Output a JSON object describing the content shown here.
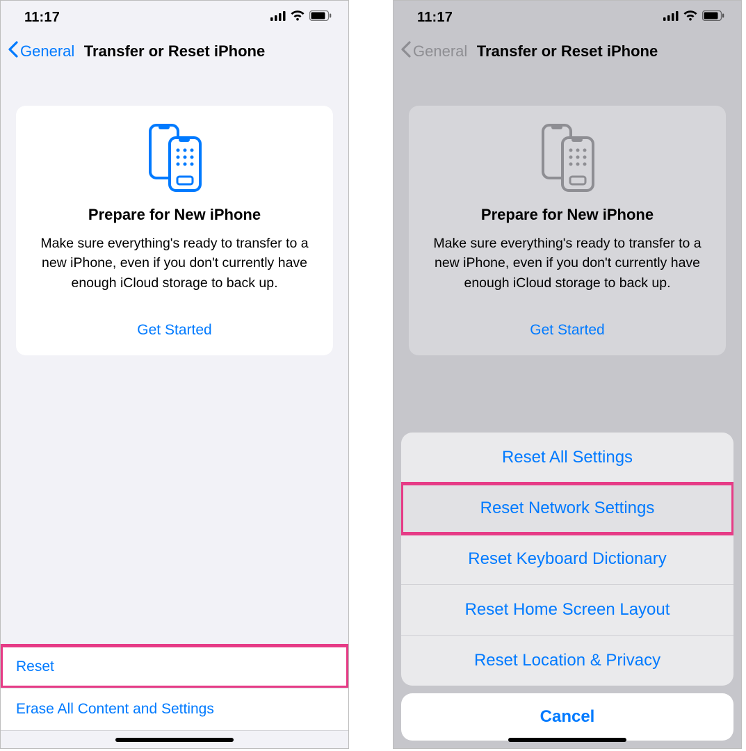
{
  "colors": {
    "accent": "#007aff",
    "highlight": "#e63b86"
  },
  "status": {
    "time": "11:17"
  },
  "nav": {
    "back": "General",
    "title": "Transfer or Reset iPhone"
  },
  "card": {
    "title": "Prepare for New iPhone",
    "body": "Make sure everything's ready to transfer to a new iPhone, even if you don't currently have enough iCloud storage to back up.",
    "cta": "Get Started"
  },
  "bottom_list": {
    "reset": "Reset",
    "erase": "Erase All Content and Settings"
  },
  "sheet": {
    "items": [
      "Reset All Settings",
      "Reset Network Settings",
      "Reset Keyboard Dictionary",
      "Reset Home Screen Layout",
      "Reset Location & Privacy"
    ],
    "cancel": "Cancel"
  }
}
